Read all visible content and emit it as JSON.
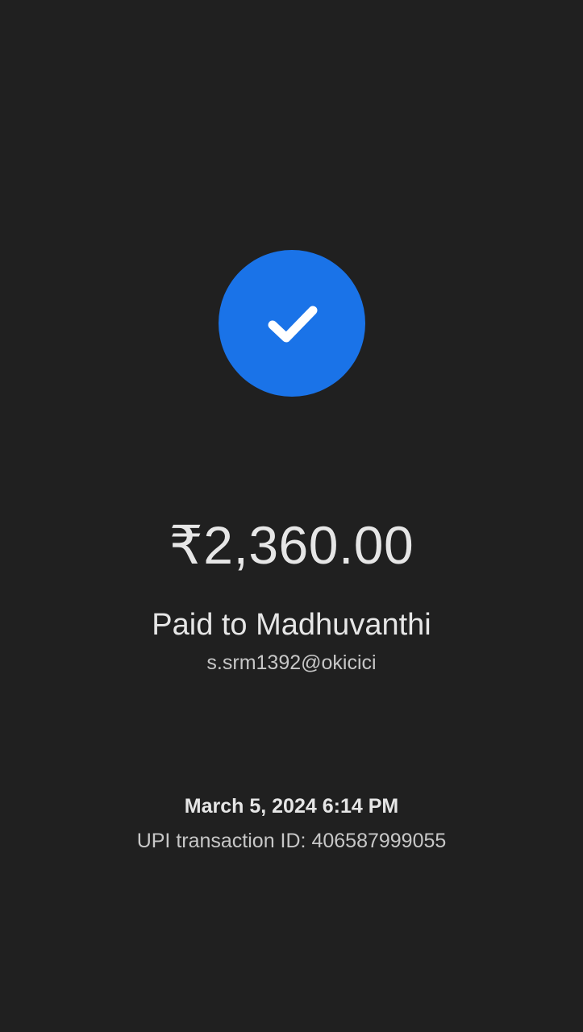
{
  "payment": {
    "status_icon": "check-icon",
    "amount": "₹2,360.00",
    "paid_to": "Paid to Madhuvanthi",
    "upi_handle": "s.srm1392@okicici",
    "datetime": "March 5, 2024 6:14 PM",
    "transaction_id": "UPI transaction ID: 406587999055"
  },
  "colors": {
    "background": "#202020",
    "accent": "#1a73e8",
    "text_primary": "#e6e6e6",
    "text_secondary": "#c7c7c7"
  }
}
